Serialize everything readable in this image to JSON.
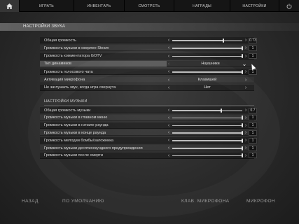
{
  "nav": {
    "tabs": [
      "ИГРАТЬ",
      "ИНВЕНТАРЬ",
      "СМОТРЕТЬ",
      "НАГРАДЫ",
      "НАСТРОЙКИ"
    ],
    "home_icon": "home-icon",
    "power_icon": "power-icon"
  },
  "subtitle": "НАСТРОЙКИ ЗВУКА",
  "audio": {
    "rows": [
      {
        "label": "Общая громкость",
        "type": "slider",
        "level": 0.73,
        "value": "0.73"
      },
      {
        "label": "Громкость музыки в оверлее Steam",
        "type": "slider",
        "level": 1,
        "value": "1"
      },
      {
        "label": "Громкость комментатора GOTV",
        "type": "slider",
        "level": 1,
        "value": "1"
      },
      {
        "label": "Тип динамиков",
        "type": "choice",
        "value": "Наушники",
        "highlighted": true
      },
      {
        "label": "Громкость голосового чата",
        "type": "slider",
        "level": 1,
        "value": "1"
      },
      {
        "label": "Активация микрофона",
        "type": "choice",
        "value": "Клавишей"
      },
      {
        "label": "Не заглушать звук, когда игра свернута",
        "type": "choice",
        "value": "Нет"
      }
    ]
  },
  "music": {
    "title": "НАСТРОЙКИ МУЗЫКИ",
    "rows": [
      {
        "label": "Общая громкость музыки",
        "level": 0.7,
        "value": "0.7"
      },
      {
        "label": "Громкость музыки в главном меню",
        "level": 1,
        "value": "1"
      },
      {
        "label": "Громкость музыки в начале раунда",
        "level": 1,
        "value": "1"
      },
      {
        "label": "Громкость музыки в конце раунда",
        "level": 1,
        "value": "1"
      },
      {
        "label": "Громкость мелодии бомбы/заложника",
        "level": 1,
        "value": "1"
      },
      {
        "label": "Громкость музыки десятисекундного предупреждения",
        "level": 1,
        "value": "1"
      },
      {
        "label": "Громкость музыки после смерти",
        "level": 1,
        "value": "1"
      }
    ]
  },
  "footer": {
    "back": "НАЗАД",
    "defaults": "ПО УМОЛЧАНИЮ",
    "mic_key": "КЛАВ. МИКРОФОНА",
    "mic": "МИКРОФОН"
  },
  "colors": {
    "accent": "#e0e0e0",
    "background": "#2b2b2b"
  }
}
